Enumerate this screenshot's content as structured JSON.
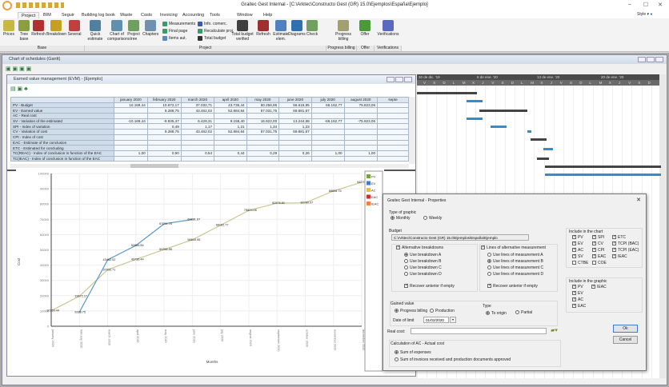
{
  "app": {
    "title": "Graitec Gest Internal - [C:\\Arktec\\Constructo Gest (GR) 15.0\\Ejemplos\\España\\Ejemplo]",
    "style_label": "Style"
  },
  "menu_tabs": [
    "Project",
    "BIM",
    "Seguir",
    "Building log book",
    "Waste",
    "Costs",
    "Invoicing",
    "Accounting",
    "Tools",
    "Window",
    "Help"
  ],
  "ribbon": {
    "large": [
      "Prices",
      "Tree base",
      "Refresh",
      "Breakdown",
      "Several",
      "Quick estimate",
      "Chart of comparisons",
      "Project tree",
      "Chapters",
      "Total budget verified",
      "Refresh",
      "Estimate elem.",
      "Diagrams",
      "Check",
      "Progress billing",
      "Offer",
      "Verifications"
    ],
    "small": [
      "Measurements",
      "Final page",
      "Items aut.",
      "Info. comerc.",
      "Recalculate proj.",
      "Total budget"
    ],
    "groups": [
      "Base",
      "Project",
      "Progress billing",
      "Offer",
      "Verifications"
    ]
  },
  "gantt_window": {
    "title": "Chart of schedules (Gantt)",
    "weeks": [
      "30 de dic. '19",
      "6 de ene. '20",
      "13 de ene. '20",
      "20 de ene. '20"
    ],
    "days": [
      "V",
      "S",
      "D",
      "L",
      "M",
      "X",
      "J",
      "V",
      "S",
      "D",
      "L",
      "M",
      "X",
      "J",
      "V",
      "S",
      "D",
      "L",
      "M",
      "X",
      "J",
      "V",
      "S",
      "D"
    ]
  },
  "evm_window": {
    "title": "Earned value management (EVM) - [Ejemplo]",
    "columns": [
      "january 2020",
      "february 2020",
      "march 2020",
      "april 2020",
      "may 2020",
      "june 2020",
      "july 2020",
      "august 2020",
      "septe"
    ],
    "rows": [
      {
        "label": "PV - Budget",
        "values": [
          "10.169,44",
          "10.672,17",
          "37.032,71",
          "43.736,44",
          "50.256,95",
          "56.616,95",
          "66.162,77",
          "75.823,06",
          ""
        ]
      },
      {
        "label": "EV - Earned value",
        "values": [
          "",
          "9.288,75",
          "43.462,02",
          "52.884,84",
          "67.031,75",
          "69.881,67",
          "",
          "",
          ""
        ]
      },
      {
        "label": "AC - Real cost",
        "values": [
          "",
          "",
          "",
          "",
          "",
          "",
          "",
          "",
          ""
        ]
      },
      {
        "label": "SV - Variation of the estimated",
        "values": [
          "-10.169,44",
          "-9.935,47",
          "6.429,31",
          "9.158,40",
          "16.822,00",
          "13.244,68",
          "-66.162,77",
          "-75.823,06",
          ""
        ]
      },
      {
        "label": "SPI - Index of variation",
        "values": [
          "",
          "0,49",
          "1,17",
          "1,21",
          "1,34",
          "1,23",
          "",
          "",
          ""
        ]
      },
      {
        "label": "CV - Variation of cost",
        "values": [
          "",
          "9.288,75",
          "43.462,02",
          "52.884,84",
          "67.031,75",
          "69.881,67",
          "",
          "",
          ""
        ]
      },
      {
        "label": "CPI - Index of cost",
        "values": [
          "",
          "",
          "",
          "",
          "",
          "",
          "",
          "",
          ""
        ]
      },
      {
        "label": "EAC - Estimate of the conclusion",
        "values": [
          "",
          "",
          "",
          "",
          "",
          "",
          "",
          "",
          ""
        ]
      },
      {
        "label": "ETC - Estimated for concluding",
        "values": [
          "",
          "",
          "",
          "",
          "",
          "",
          "",
          "",
          ""
        ]
      },
      {
        "label": "TC(REAC) - Index of conclusion in function of the EAC",
        "values": [
          "1,00",
          "0,90",
          "0,54",
          "0,44",
          "0,29",
          "0,26",
          "1,00",
          "1,00",
          ""
        ]
      },
      {
        "label": "TC(IEAC) - Index of conclusion in function of the EAC",
        "values": [
          "",
          "",
          "",
          "",
          "",
          "",
          "",
          "",
          ""
        ]
      }
    ]
  },
  "chart_data": {
    "type": "line",
    "xlabel": "Months",
    "ylabel": "Cost",
    "ylim": [
      0,
      100000
    ],
    "yticks": [
      "0",
      "10000",
      "20000",
      "30000",
      "40000",
      "50000",
      "60000",
      "70000",
      "80000",
      "90000",
      "100000"
    ],
    "categories": [
      "january 2020",
      "february 2020",
      "march 2020",
      "april 2020",
      "may 2020",
      "june 2020",
      "july 2020",
      "august 2020",
      "september 2020",
      "october 2020",
      "november 2020",
      "december 2020"
    ],
    "legend": [
      "PV",
      "EV",
      "AC",
      "EAC",
      "IEAC"
    ],
    "legend_colors": [
      "#77a33a",
      "#3c7fc0",
      "#e5c13a",
      "#d0312d",
      "#e8863a"
    ],
    "series": [
      {
        "name": "PV",
        "color": "#c8c890",
        "values": [
          10169.44,
          19672.17,
          37032.71,
          43736.44,
          50256.95,
          56616.95,
          66162.77,
          75823.06,
          80576.81,
          80780.07,
          88608.75,
          94270
        ]
      },
      {
        "name": "EV",
        "color": "#5c98c4",
        "values": [
          null,
          9288.75,
          43462.02,
          52884.84,
          67031.75,
          69881.67,
          null,
          null,
          null,
          null,
          null,
          null
        ]
      }
    ]
  },
  "dialog": {
    "title": "Graitec Gest Internal - Properties",
    "type_label": "Type of graphic",
    "monthly": "Monthly",
    "weekly": "Weekly",
    "budget_label": "Budget",
    "budget_path": "C:\\Arktec\\Constructo Gest (GR) 15.0\\Ejemplos\\España\\Ejemplo",
    "alt_breakdowns": "Alternative breakdowns",
    "breakdowns": [
      "Use breakdown A",
      "Use breakdown B",
      "Use breakdown C",
      "Use breakdown D"
    ],
    "alt_lines": "Lines of alternative measurement",
    "lines": [
      "Use lines of measurement A",
      "Use lines of measurement B",
      "Use lines of measurement C",
      "Use lines of measurement D"
    ],
    "recover": "Recover anterior if empty",
    "chart_label": "Include in the chart",
    "chart_items": [
      {
        "l": "PV",
        "on": true
      },
      {
        "l": "SPI",
        "on": true
      },
      {
        "l": "ETC",
        "on": true
      },
      {
        "l": "EV",
        "on": true
      },
      {
        "l": "CV",
        "on": true
      },
      {
        "l": "TCPI (BAC)",
        "on": true
      },
      {
        "l": "AC",
        "on": true
      },
      {
        "l": "CPI",
        "on": true
      },
      {
        "l": "TCPI (EAC)",
        "on": true
      },
      {
        "l": "SV",
        "on": true
      },
      {
        "l": "EAC",
        "on": true
      },
      {
        "l": "IEAC",
        "on": true
      },
      {
        "l": "CTBE",
        "on": false
      },
      {
        "l": "COE",
        "on": false
      }
    ],
    "graphic_label": "Include in the graphic",
    "graphic_items": [
      {
        "l": "PV",
        "on": true
      },
      {
        "l": "IEAC",
        "on": true
      },
      {
        "l": "EV",
        "on": true
      },
      {
        "l": "AC",
        "on": true
      },
      {
        "l": "EAC",
        "on": true
      }
    ],
    "gained_label": "Gained value",
    "progress_billing": "Progress billing",
    "production": "Production",
    "date_label": "Date of limit",
    "date_value": "01/02/2020",
    "type2_label": "Type",
    "to_origin": "To origin",
    "partial": "Partial",
    "real_cost_label": "Real cost:",
    "real_cost_value": "",
    "calc_label": "Calculation of AC - Actual cost",
    "sum_expenses": "Sum of expenses",
    "sum_invoices": "Sum of invoices received and production documents approved",
    "ok": "Ok",
    "cancel": "Cancel"
  }
}
